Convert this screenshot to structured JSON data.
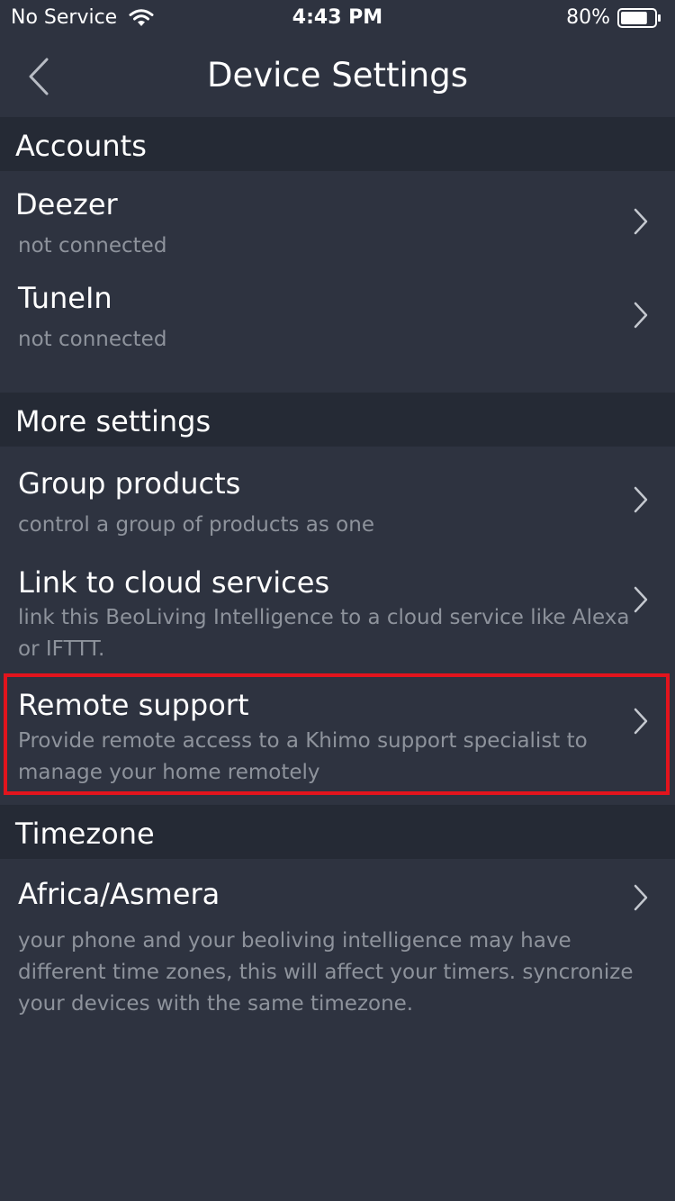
{
  "status_bar": {
    "carrier": "No Service",
    "time": "4:43 PM",
    "battery": "80%",
    "battery_level_fraction": 0.8
  },
  "nav": {
    "title": "Device Settings",
    "back_icon": "chevron-left-icon"
  },
  "sections": {
    "accounts": {
      "header": "Accounts",
      "items": [
        {
          "title": "Deezer",
          "subtitle": "not connected"
        },
        {
          "title": "TuneIn",
          "subtitle": "not connected"
        }
      ]
    },
    "more_settings": {
      "header": "More settings",
      "items": [
        {
          "title": "Group products",
          "subtitle": "control a group of products as one"
        },
        {
          "title": "Link to cloud services",
          "subtitle": "link this BeoLiving Intelligence to a cloud service like Alexa or IFTTT."
        },
        {
          "title": "Remote support",
          "subtitle": "Provide remote access to a Khimo support specialist to manage your home remotely"
        }
      ]
    },
    "timezone": {
      "header": "Timezone",
      "items": [
        {
          "title": "Africa/Asmera",
          "subtitle": "your phone and your beoliving intelligence may have different time zones, this will affect your timers. syncronize your devices with the same timezone."
        }
      ]
    }
  },
  "colors": {
    "background": "#2e3340",
    "section_header": "#252a35",
    "subtitle_text": "#8e939c",
    "highlight": "#e2141d"
  }
}
